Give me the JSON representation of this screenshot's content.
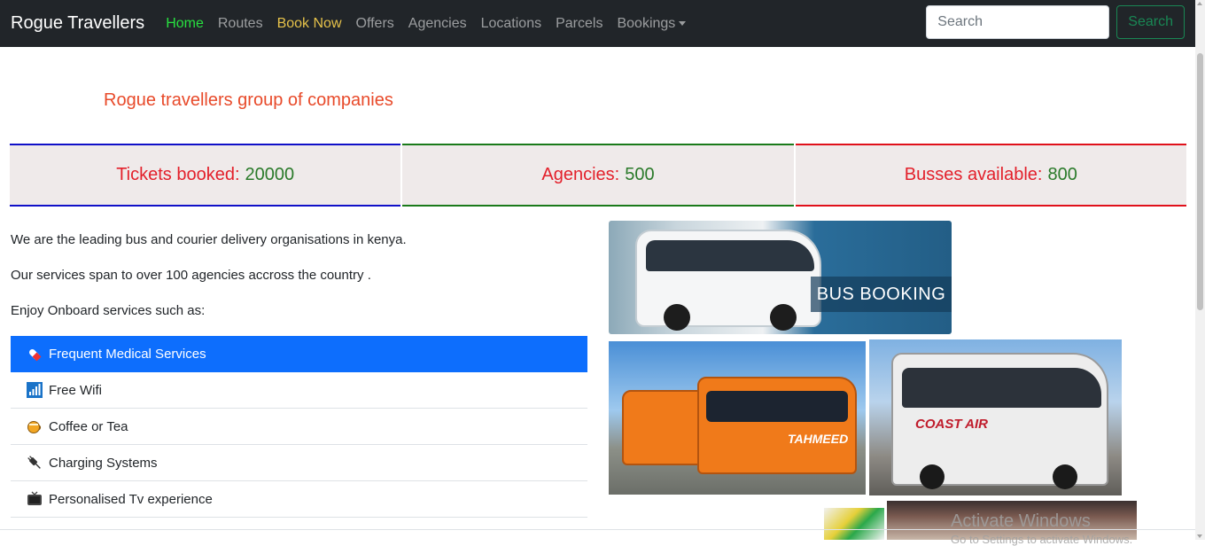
{
  "navbar": {
    "brand": "Rogue Travellers",
    "links": [
      {
        "label": "Home"
      },
      {
        "label": "Routes"
      },
      {
        "label": "Book Now"
      },
      {
        "label": "Offers"
      },
      {
        "label": "Agencies"
      },
      {
        "label": "Locations"
      },
      {
        "label": "Parcels"
      },
      {
        "label": "Bookings"
      }
    ],
    "search_placeholder": "Search",
    "search_button": "Search"
  },
  "colors": {
    "navbar_bg": "#212529",
    "home_active": "#28e040",
    "book_now": "#e6c24a",
    "accent_blue": "#0d6efd",
    "tagline": "#e84a2a"
  },
  "hero": {
    "tagline": "Rogue travellers group of companies"
  },
  "stats": [
    {
      "label": "Tickets booked:",
      "value": "20000"
    },
    {
      "label": "Agencies:",
      "value": "500"
    },
    {
      "label": "Busses available:",
      "value": "800"
    }
  ],
  "about": {
    "p1": "We are the leading bus and courier delivery organisations in kenya.",
    "p2": "Our services span to over 100 agencies accross the country .",
    "p3": "Enjoy Onboard services such as:"
  },
  "services": [
    {
      "label": "Frequent Medical Services",
      "icon": "pill-icon"
    },
    {
      "label": "Free Wifi",
      "icon": "signal-icon"
    },
    {
      "label": "Coffee or Tea",
      "icon": "cup-icon"
    },
    {
      "label": "Charging Systems",
      "icon": "plug-icon"
    },
    {
      "label": "Personalised Tv experience",
      "icon": "tv-icon"
    }
  ],
  "images": {
    "bus_booking_banner": "BUS BOOKING",
    "orange_bus_text": "TAHMEED",
    "coast_bus_text": "COAST AIR"
  },
  "os_overlay": {
    "line1": "Activate Windows",
    "line2": "Go to Settings to activate Windows."
  }
}
